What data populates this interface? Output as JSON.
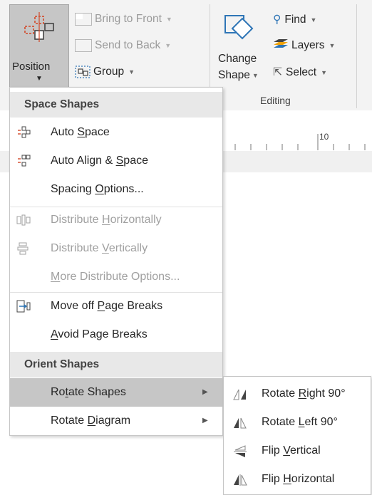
{
  "ribbon": {
    "position": {
      "label": "Position"
    },
    "bring_to_front": {
      "label": "Bring to Front"
    },
    "send_to_back": {
      "label": "Send to Back"
    },
    "group": {
      "label": "Group"
    },
    "change_shape": {
      "line1": "Change",
      "line2": "Shape"
    },
    "find": {
      "label": "Find"
    },
    "layers": {
      "label": "Layers"
    },
    "select": {
      "label": "Select"
    },
    "editing_group": {
      "label": "Editing"
    },
    "ruler_number": "10"
  },
  "menu": {
    "space_header": "Space Shapes",
    "auto_space": {
      "pre": "Auto ",
      "key": "S",
      "post": "pace"
    },
    "auto_align_space": {
      "pre": "Auto Align & ",
      "key": "S",
      "post": "pace"
    },
    "spacing_options": {
      "pre": "Spacing ",
      "key": "O",
      "post": "ptions..."
    },
    "distribute_h": {
      "pre": "Distribute ",
      "key": "H",
      "post": "orizontally"
    },
    "distribute_v": {
      "pre": "Distribute ",
      "key": "V",
      "post": "ertically"
    },
    "more_distribute": {
      "pre": "",
      "key": "M",
      "post": "ore Distribute Options..."
    },
    "move_off_breaks": {
      "pre": "Move off ",
      "key": "P",
      "post": "age Breaks"
    },
    "avoid_breaks": {
      "pre": "",
      "key": "A",
      "post": "void Page Breaks"
    },
    "orient_header": "Orient Shapes",
    "rotate_shapes": {
      "pre": "Ro",
      "key": "t",
      "post": "ate Shapes"
    },
    "rotate_diagram": {
      "pre": "Rotate ",
      "key": "D",
      "post": "iagram"
    }
  },
  "submenu": {
    "rotate_right": {
      "pre": "Rotate ",
      "key": "R",
      "post": "ight 90°"
    },
    "rotate_left": {
      "pre": "Rotate ",
      "key": "L",
      "post": "eft 90°"
    },
    "flip_vertical": {
      "pre": "Flip ",
      "key": "V",
      "post": "ertical"
    },
    "flip_horizontal": {
      "pre": "Flip ",
      "key": "H",
      "post": "orizontal"
    }
  },
  "colors": {
    "highlight": "#c6c6c6",
    "header_bg": "#e8e8e8",
    "disabled_text": "#a0a0a0",
    "icon_blue": "#2e75b6",
    "icon_orange": "#d24726"
  }
}
